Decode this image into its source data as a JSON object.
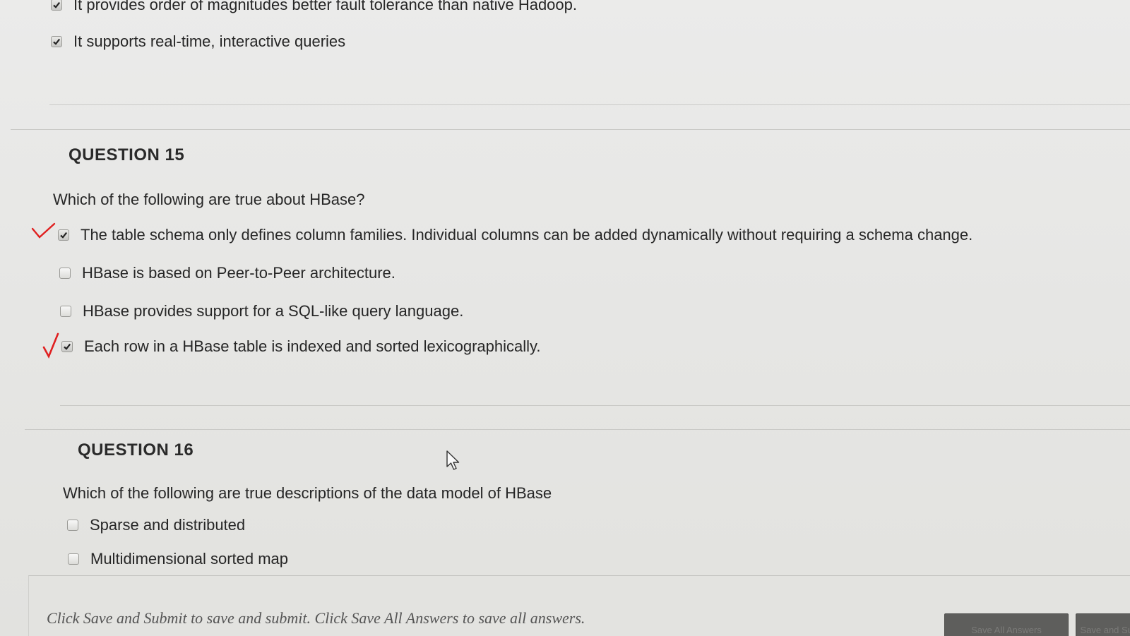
{
  "prev_question": {
    "options": [
      {
        "label": "It provides order of magnitudes better fault tolerance than native Hadoop.",
        "checked": true
      },
      {
        "label": "It supports real-time, interactive queries",
        "checked": true
      }
    ]
  },
  "question15": {
    "title": "QUESTION 15",
    "text": "Which of the following are true about HBase?",
    "options": [
      {
        "label": "The table schema only defines column families. Individual columns can be added dynamically without requiring a schema change.",
        "checked": true
      },
      {
        "label": "HBase is based on Peer-to-Peer architecture.",
        "checked": false
      },
      {
        "label": "HBase provides support for a SQL-like query language.",
        "checked": false
      },
      {
        "label": "Each row in a HBase table is indexed and sorted lexicographically.",
        "checked": true
      }
    ]
  },
  "question16": {
    "title": "QUESTION 16",
    "text": "Which of the following are true descriptions of the data model of HBase",
    "options": [
      {
        "label": "Sparse and distributed",
        "checked": false
      },
      {
        "label": "Multidimensional sorted map",
        "checked": false
      }
    ]
  },
  "footer": {
    "instructions": "Click Save and Submit to save and submit. Click Save All Answers to save all answers.",
    "save_all_label": "Save All Answers",
    "submit_label": "Save and Submit"
  },
  "colors": {
    "annotation_mark": "#e02020",
    "background": "#e9e9e7"
  }
}
